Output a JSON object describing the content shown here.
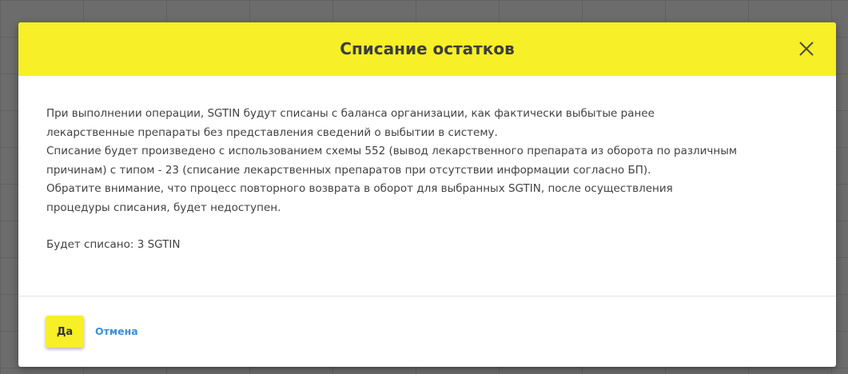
{
  "dialog": {
    "title": "Списание остатков",
    "body_lines": [
      "При выполнении операции, SGTIN будут списаны с баланса организации, как фактически выбытые ранее",
      "лекарственные препараты без представления сведений о выбытии в систему.",
      "Списание будет произведено с использованием схемы 552 (вывод лекарственного препарата из оборота по различным",
      "причинам) с типом - 23 (списание лекарственных препаратов при отсутствии информации согласно БП).",
      "Обратите внимание, что процесс повторного возврата в оборот для выбранных SGTIN, после осуществления",
      "процедуры списания, будет недоступен."
    ],
    "count_text": "Будет списано: 3 SGTIN",
    "confirm_label": "Да",
    "cancel_label": "Отмена",
    "close_icon": "close-icon"
  },
  "colors": {
    "header_bg": "#f7ef27",
    "confirm_bg": "#f7ef27",
    "link": "#3d8fd6",
    "text": "#424242",
    "overlay": "#6c6c6c"
  }
}
